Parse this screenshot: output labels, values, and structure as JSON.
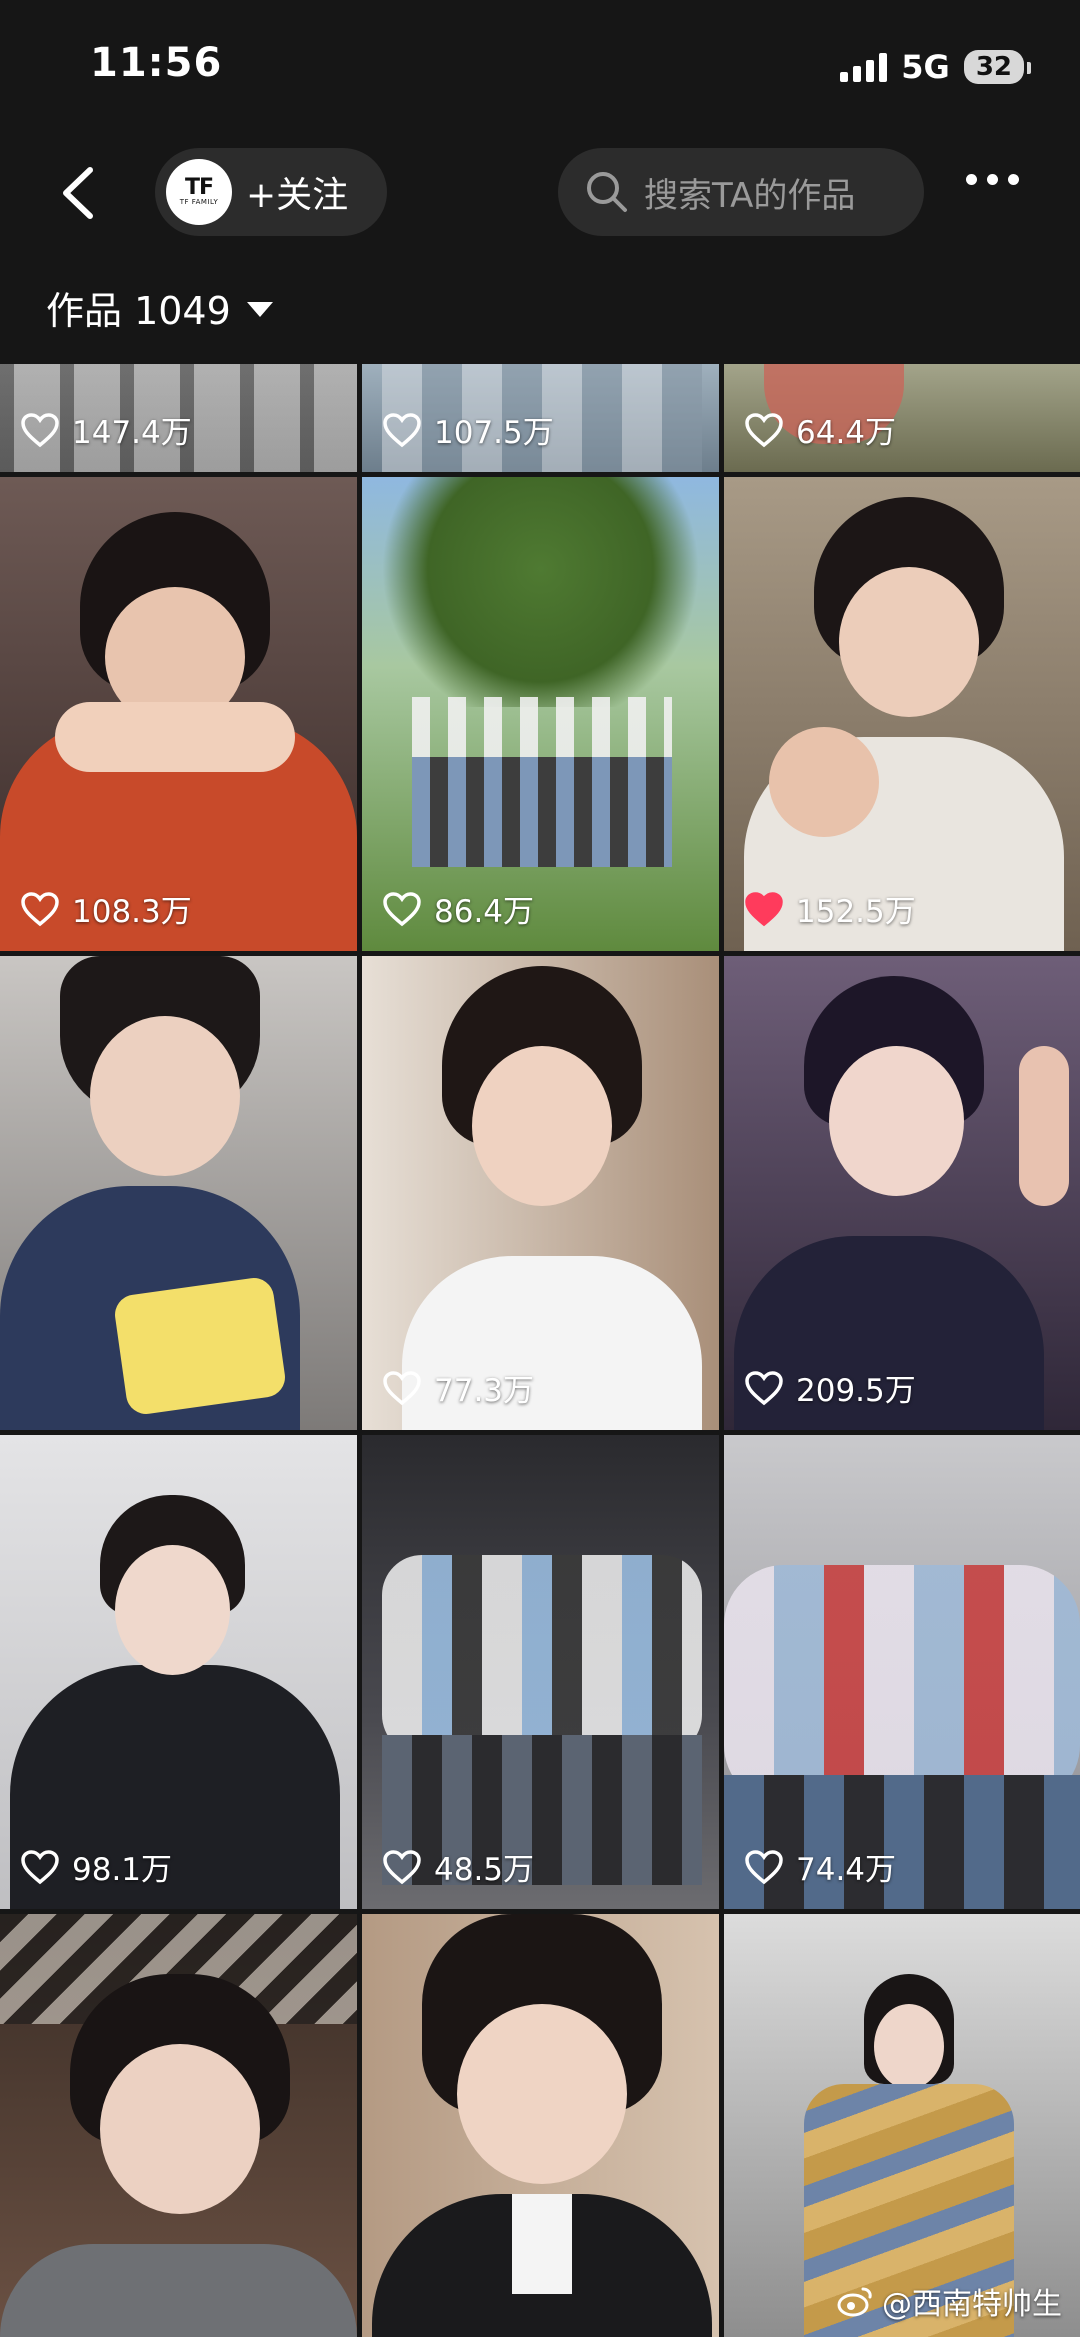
{
  "status_bar": {
    "time": "11:56",
    "network": "5G",
    "battery": "32"
  },
  "header": {
    "follow_label": "+关注",
    "brand_mark": "TF",
    "brand_sub": "TF FAMILY",
    "search_placeholder": "搜索TA的作品"
  },
  "works": {
    "label": "作品 1049"
  },
  "tiles": [
    {
      "likes": "147.4万",
      "liked": false
    },
    {
      "likes": "107.5万",
      "liked": false
    },
    {
      "likes": "64.4万",
      "liked": false
    },
    {
      "likes": "108.3万",
      "liked": false
    },
    {
      "likes": "86.4万",
      "liked": false
    },
    {
      "likes": "152.5万",
      "liked": true
    },
    {
      "likes": "",
      "liked": false
    },
    {
      "likes": "77.3万",
      "liked": false
    },
    {
      "likes": "209.5万",
      "liked": false
    },
    {
      "likes": "98.1万",
      "liked": false
    },
    {
      "likes": "48.5万",
      "liked": false
    },
    {
      "likes": "74.4万",
      "liked": false
    },
    {
      "likes": "",
      "liked": false
    },
    {
      "likes": "",
      "liked": false
    },
    {
      "likes": "",
      "liked": false
    }
  ],
  "watermark": {
    "text": "@西南特帅生",
    "icon": "weibo-icon"
  },
  "colors": {
    "background": "#161616",
    "pill": "#2c2c2c",
    "liked_heart": "#ff3b5c"
  }
}
